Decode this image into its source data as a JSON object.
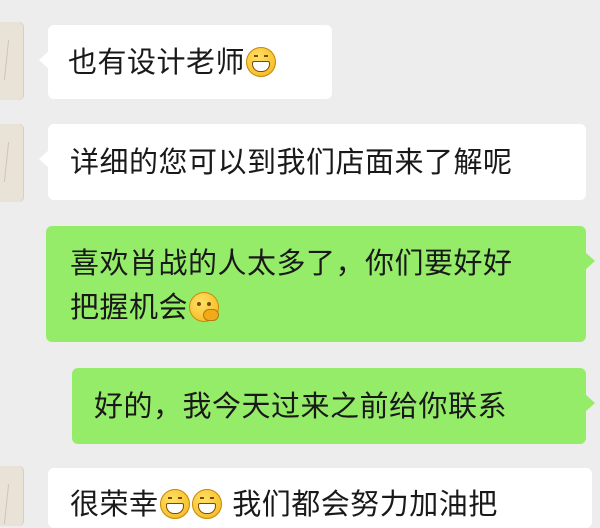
{
  "chat": {
    "messages": [
      {
        "side": "left",
        "text": "也有设计老师",
        "emoji": [
          "grinning-face"
        ]
      },
      {
        "side": "left",
        "text": "详细的您可以到我们店面来了解呢"
      },
      {
        "side": "right",
        "line1": "喜欢肖战的人太多了，你们要好好",
        "line2": "把握机会",
        "emoji": [
          "thinking-face"
        ]
      },
      {
        "side": "right",
        "text": "好的，我今天过来之前给你联系"
      },
      {
        "side": "left",
        "text_before": "很荣幸",
        "text_after": "我们都会努力加油把",
        "emoji": [
          "grinning-face",
          "grinning-face"
        ]
      }
    ]
  },
  "colors": {
    "background": "#ededed",
    "incoming_bubble": "#ffffff",
    "outgoing_bubble": "#95ec69"
  }
}
